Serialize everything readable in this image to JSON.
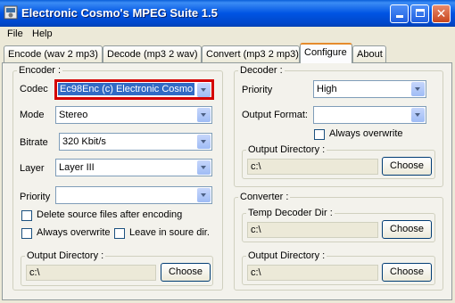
{
  "window": {
    "title": "Electronic Cosmo's MPEG Suite 1.5"
  },
  "menu": [
    "File",
    "Help"
  ],
  "tabs": [
    "Encode (wav 2 mp3)",
    "Decode (mp3 2 wav)",
    "Convert (mp3 2 mp3)",
    "Configure",
    "About"
  ],
  "active_tab": "Configure",
  "encoder": {
    "title": "Encoder :",
    "codec": {
      "label": "Codec",
      "value": "Ec98Enc   (c) Electronic Cosmo"
    },
    "mode": {
      "label": "Mode",
      "value": "Stereo"
    },
    "bitrate": {
      "label": "Bitrate",
      "value": "320 Kbit/s"
    },
    "layer": {
      "label": "Layer",
      "value": "Layer III"
    },
    "priority": {
      "label": "Priority",
      "value": ""
    },
    "delete_source": "Delete source files after encoding",
    "always_overwrite": "Always overwrite",
    "leave_in_source": "Leave in soure dir.",
    "output_dir": {
      "title": "Output Directory :",
      "value": "c:\\",
      "button": "Choose"
    }
  },
  "decoder": {
    "title": "Decoder :",
    "priority": {
      "label": "Priority",
      "value": "High"
    },
    "output_format": {
      "label": "Output Format:",
      "value": ""
    },
    "always_overwrite": "Always overwrite",
    "output_dir": {
      "title": "Output Directory :",
      "value": "c:\\",
      "button": "Choose"
    }
  },
  "converter": {
    "title": "Converter :",
    "temp_dir": {
      "title": "Temp Decoder Dir :",
      "value": "c:\\",
      "button": "Choose"
    },
    "output_dir": {
      "title": "Output Directory :",
      "value": "c:\\",
      "button": "Choose"
    }
  }
}
